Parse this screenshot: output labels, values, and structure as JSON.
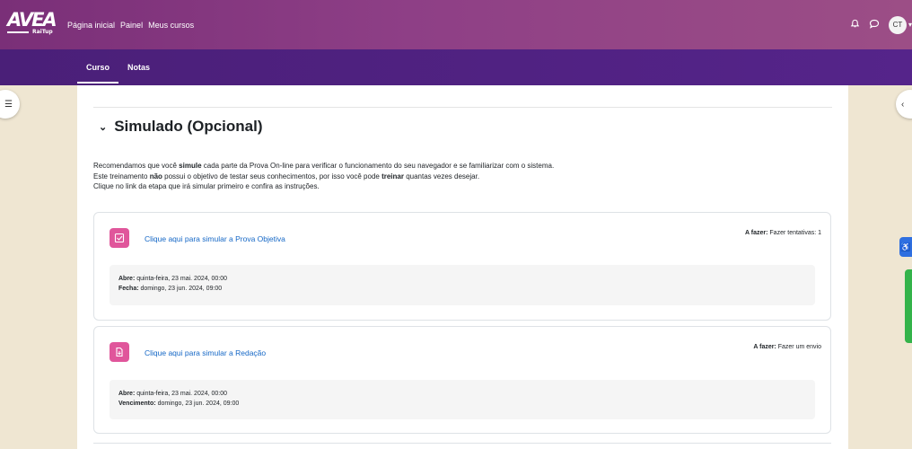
{
  "brand": {
    "logo_text": "AVEA",
    "logo_sub": "RaiTup"
  },
  "topnav": {
    "items": [
      {
        "label": "Página inicial"
      },
      {
        "label": "Painel"
      },
      {
        "label": "Meus cursos"
      }
    ]
  },
  "user": {
    "initials": "CT"
  },
  "icons": {
    "bell": "bell-icon",
    "chat": "chat-icon",
    "caret": "chevron-down-icon"
  },
  "subnav": {
    "tabs": [
      {
        "label": "Curso",
        "active": true
      },
      {
        "label": "Notas",
        "active": false
      }
    ]
  },
  "section": {
    "title": "Simulado (Opcional)",
    "summary": {
      "line1_pre": "Recomendamos que você ",
      "line1_bold": "simule",
      "line1_post": " cada parte da Prova On-line para verificar o funcionamento do seu navegador e se familiarizar com o sistema.",
      "line2_pre": "Este treinamento ",
      "line2_bold1": "não",
      "line2_mid": " possui o objetivo de testar seus conhecimentos, por isso você pode ",
      "line2_bold2": "treinar",
      "line2_post": " quantas vezes desejar.",
      "line3": "Clique no link da etapa que irá simular primeiro e confira as instruções."
    }
  },
  "activities": [
    {
      "link": "Clique aqui para simular a Prova Objetiva",
      "status_label": "A fazer:",
      "status_value": "Fazer tentativas: 1",
      "date1_label": "Abre:",
      "date1_value": "quinta-feira, 23 mai. 2024, 00:00",
      "date2_label": "Fecha:",
      "date2_value": "domingo, 23 jun. 2024, 09:00",
      "icon": "quiz-icon"
    },
    {
      "link": "Clique aqui para simular a Redação",
      "status_label": "A fazer:",
      "status_value": "Fazer um envio",
      "date1_label": "Abre:",
      "date1_value": "quinta-feira, 23 mai. 2024, 00:00",
      "date2_label": "Vencimento:",
      "date2_value": "domingo, 23 jun. 2024, 09:00",
      "icon": "assignment-icon"
    }
  ],
  "colors": {
    "topbar": "#8e3f86",
    "subbar": "#55248a",
    "activity_icon": "#e0569b",
    "link": "#1467c6"
  }
}
